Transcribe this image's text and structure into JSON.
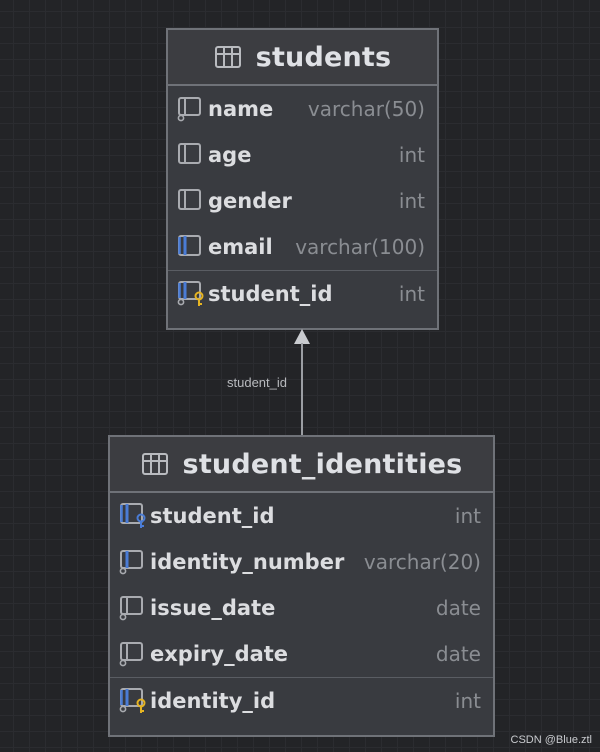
{
  "tables": {
    "students": {
      "title": "students",
      "columns": [
        {
          "name": "name",
          "type": "varchar(50)",
          "icon": "column-icon"
        },
        {
          "name": "age",
          "type": "int",
          "icon": "column-icon"
        },
        {
          "name": "gender",
          "type": "int",
          "icon": "column-icon"
        },
        {
          "name": "email",
          "type": "varchar(100)",
          "icon": "indexed-column-icon"
        },
        {
          "name": "student_id",
          "type": "int",
          "icon": "primary-key-icon"
        }
      ]
    },
    "student_identities": {
      "title": "student_identities",
      "columns": [
        {
          "name": "student_id",
          "type": "int",
          "icon": "foreign-key-icon"
        },
        {
          "name": "identity_number",
          "type": "varchar(20)",
          "icon": "indexed-column-icon"
        },
        {
          "name": "issue_date",
          "type": "date",
          "icon": "column-icon"
        },
        {
          "name": "expiry_date",
          "type": "date",
          "icon": "column-icon"
        },
        {
          "name": "identity_id",
          "type": "int",
          "icon": "primary-key-icon"
        }
      ]
    }
  },
  "relation": {
    "label": "student_id"
  },
  "watermark": "CSDN @Blue.ztl",
  "colors": {
    "background": "#232427",
    "card": "#393b40",
    "border": "#6f7278",
    "key_yellow": "#e6b422",
    "index_blue": "#4a7cd6",
    "column_gray": "#a9abb0"
  }
}
